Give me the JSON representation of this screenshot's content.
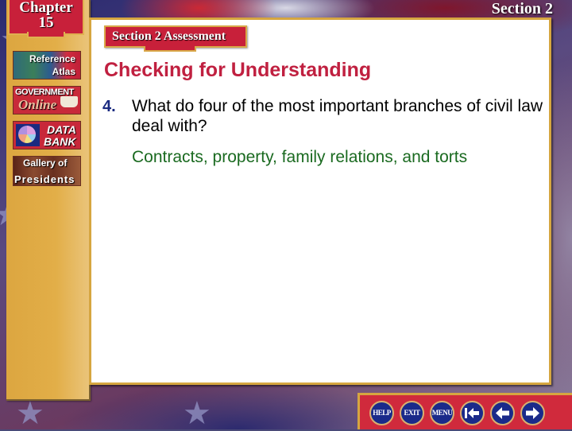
{
  "header": {
    "chapter_word": "Chapter",
    "chapter_number": "15",
    "section_label": "Section 2"
  },
  "sidebar": {
    "items": [
      {
        "line1": "Reference",
        "line2": "Atlas"
      },
      {
        "line1": "GOVERNMENT",
        "line2": "Online"
      },
      {
        "line1": "DATA",
        "line2": "BANK"
      },
      {
        "line1": "Gallery of",
        "line2": "Presidents"
      }
    ]
  },
  "main": {
    "badge": "Section 2 Assessment",
    "heading": "Checking for Understanding",
    "question_number": "4.",
    "question_text": "What do four of the most important branches of civil law deal with?",
    "answer": "Contracts, property, family relations, and torts"
  },
  "nav": {
    "help": "HELP",
    "exit": "EXIT",
    "menu": "MENU",
    "first_icon": "first-slide-icon",
    "prev_icon": "previous-arrow-icon",
    "next_icon": "next-arrow-icon"
  },
  "colors": {
    "heading": "#c02040",
    "question_number": "#1a2a80",
    "answer": "#1a6a20",
    "badge": "#c8203a",
    "gold": "#d6a640",
    "nav_button": "#1a2a8a"
  }
}
